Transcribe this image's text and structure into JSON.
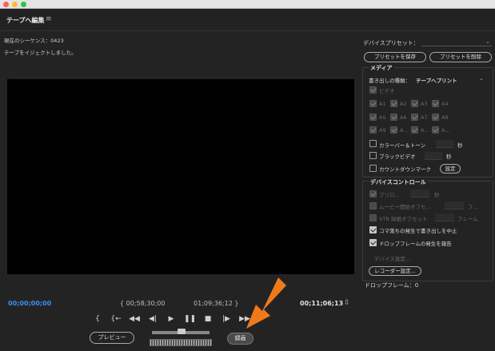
{
  "panel": {
    "title": "テープへ編集"
  },
  "sequence": {
    "label": "現在のシーケンス：0423",
    "status": "テープをイジェクトしました。"
  },
  "timecodes": {
    "current": "00;00;00;00",
    "in": "{ 00;58;30;00",
    "out": "01;09;36;12 }",
    "duration": "00;11;06;13"
  },
  "transport": {
    "mark_in": "{",
    "go_in": "{←",
    "rewind": "◀◀",
    "step_back": "◀|",
    "play": "▶",
    "pause": "❚❚",
    "stop": "■",
    "step_fwd": "|▶",
    "ffwd": "▶▶"
  },
  "buttons": {
    "preview": "プレビュー",
    "record": "録画"
  },
  "device_preset": {
    "label": "デバイスプリセット：",
    "value": "",
    "save": "プリセットを保存",
    "delete": "プリセットを削除"
  },
  "media": {
    "title": "メディア",
    "export_type_label": "書き出しの種類：",
    "export_type_value": "テープへプリント",
    "video": "ビデオ",
    "audio_row1": [
      "A1",
      "A2",
      "A3",
      "A4"
    ],
    "audio_row2": [
      "A5",
      "A6",
      "A7",
      "A8"
    ],
    "audio_row3": [
      "A9",
      "A…",
      "A…",
      "A…"
    ],
    "bars_tone": "カラーバー＆トーン",
    "bars_unit": "秒",
    "black_video": "ブラックビデオ",
    "black_unit": "秒",
    "countdown": "カウントダウンマーク",
    "countdown_settings": "設定"
  },
  "device_control": {
    "title": "デバイスコントロール",
    "preroll": "プリロ...",
    "preroll_unit": "秒",
    "movie_start": "ムービー開始オフセ...",
    "movie_unit": "フ...",
    "vtr_offset": "VTR 録画オフセット",
    "vtr_unit": "フレーム",
    "abort_drop": "コマ落ちの発生で書き出しを中止",
    "report_drop": "ドロップフレームの発生を報告",
    "device_settings": "デバイス設定...",
    "recorder_settings": "レコーダー設定..."
  },
  "dropped_frames": "ドロップフレーム：0",
  "colors": {
    "timecode_accent": "#3d8df2",
    "annotation_arrow": "#f07a1a"
  }
}
